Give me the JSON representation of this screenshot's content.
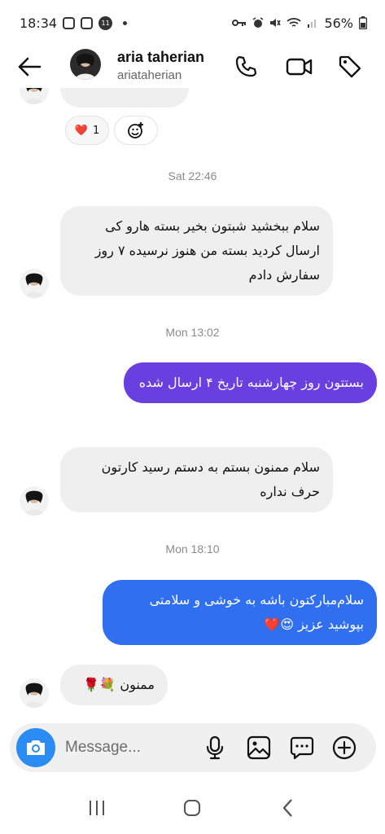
{
  "status": {
    "time": "18:34",
    "battery": "56%",
    "notif_badge": "11"
  },
  "header": {
    "name": "aria taherian",
    "username": "ariataherian"
  },
  "reaction": {
    "emoji": "❤️",
    "count": "1"
  },
  "timestamps": [
    "Sat 22:46",
    "Mon 13:02",
    "Mon 18:10"
  ],
  "messages": [
    {
      "direction": "in",
      "text": "سلام ببخشید شبتون بخیر بسته هارو کی ارسال کردید بسته من هنوز نرسیده ۷ روز سفارش دادم"
    },
    {
      "direction": "out",
      "text": "بستتون روز چهارشنبه تاریخ ۴ ارسال شده"
    },
    {
      "direction": "in",
      "text": "سلام ممنون بستم به دستم رسید کارتون حرف نداره"
    },
    {
      "direction": "out",
      "text": "سلام‌مبارکتون باشه به خوشی و سلامتی بپوشید عزیز 😍❤️"
    },
    {
      "direction": "in",
      "text": "ممنون 💐🌹"
    }
  ],
  "composer": {
    "placeholder": "Message..."
  },
  "colors": {
    "purple_bubble": "#6a3fe0",
    "blue_bubble": "#2f6ff0",
    "incoming_bubble": "#efefef",
    "camera_button": "#2a8bf2"
  }
}
